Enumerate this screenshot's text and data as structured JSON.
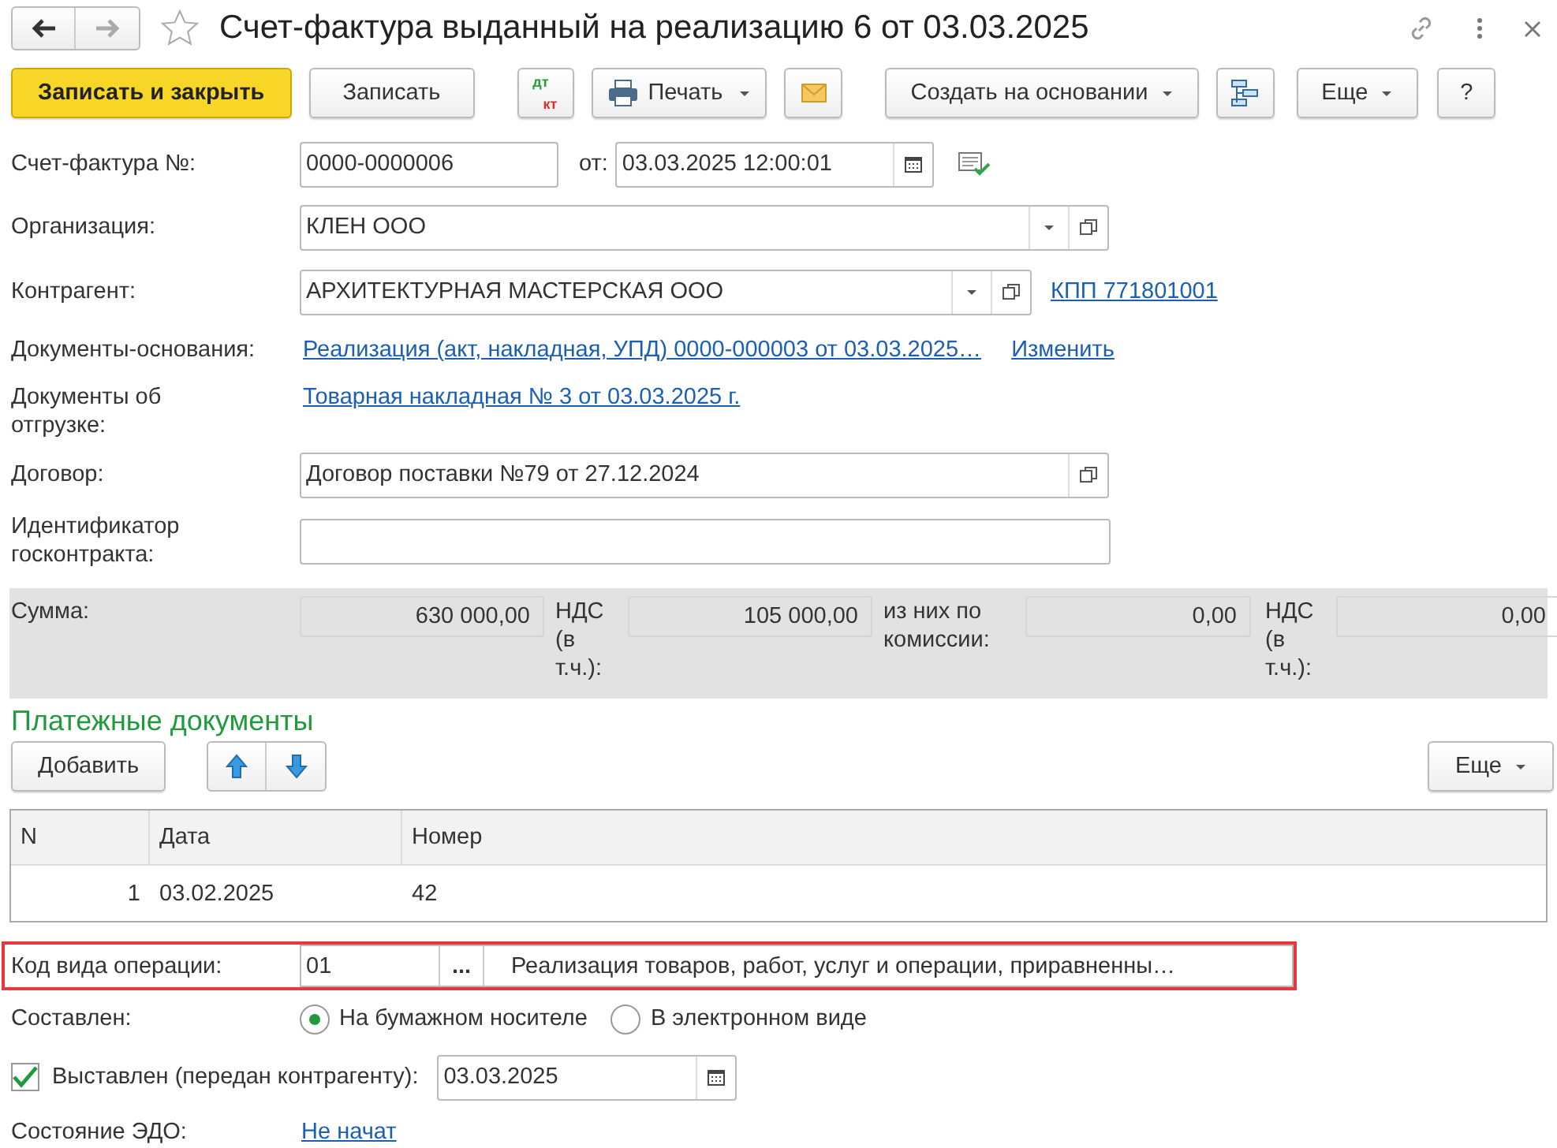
{
  "window": {
    "title": "Счет-фактура выданный на реализацию 6 от 03.03.2025",
    "favorite": false
  },
  "toolbar": [
    {
      "kind": "primary",
      "label": "Записать и закрыть"
    },
    {
      "kind": "button",
      "label": "Записать"
    },
    {
      "kind": "dtkt",
      "top": "дт",
      "bottom": "кт"
    },
    {
      "kind": "print",
      "label": "Печать"
    },
    {
      "kind": "mail"
    },
    {
      "kind": "dropdown",
      "label": "Создать на основании"
    },
    {
      "kind": "structure"
    },
    {
      "kind": "dropdown",
      "label": "Еще"
    },
    {
      "kind": "button",
      "label": "?"
    }
  ],
  "invoice_number": {
    "label": "Счет-фактура №:",
    "value": "0000-0000006",
    "date_label": "от:",
    "date": "03.03.2025 12:00:01"
  },
  "organization": {
    "label": "Организация:",
    "value": "КЛЕН ООО"
  },
  "counterparty": {
    "label": "Контрагент:",
    "value": "АРХИТЕКТУРНАЯ МАСТЕРСКАЯ ООО",
    "link": "КПП 771801001"
  },
  "base_documents": {
    "label": "Документы-основания:",
    "link": "Реализация (акт, накладная, УПД) 0000-000003 от 03.03.2025…",
    "change_link": "Изменить"
  },
  "shipping_documents": {
    "label": "Документы об отгрузке:",
    "link": "Товарная накладная № 3 от 03.03.2025 г."
  },
  "contract": {
    "label": "Договор:",
    "value": "Договор поставки №79 от 27.12.2024"
  },
  "gov_contract_id": {
    "label": "Идентификатор госконтракта:"
  },
  "totals": [
    {
      "label": "Сумма:",
      "value": "630 000,00"
    },
    {
      "label": "НДС (в т.ч.):",
      "value": "105 000,00"
    },
    {
      "label": "из них по комиссии:",
      "value": "0,00"
    },
    {
      "label": "НДС (в т.ч.):",
      "value": "0,00"
    }
  ],
  "payments": {
    "heading": "Платежные документы",
    "add_button": "Добавить",
    "more_button": "Еще",
    "columns": [
      "N",
      "Дата",
      "Номер"
    ],
    "rows": [
      [
        "1",
        "03.02.2025",
        "42"
      ]
    ]
  },
  "operation_code": {
    "label": "Код вида операции:",
    "code": "01",
    "select_button": "...",
    "description": "Реализация товаров, работ, услуг и операции, приравненны…",
    "highlighted": true
  },
  "composed": {
    "label": "Составлен:",
    "options": [
      {
        "label": "На бумажном носителе",
        "selected": true
      },
      {
        "label": "В электронном виде",
        "selected": false
      }
    ]
  },
  "issued": {
    "label": "Выставлен (передан контрагенту):",
    "checked": true,
    "date": "03.03.2025"
  },
  "edo_status": {
    "label": "Состояние ЭДО:",
    "link": "Не начат"
  }
}
